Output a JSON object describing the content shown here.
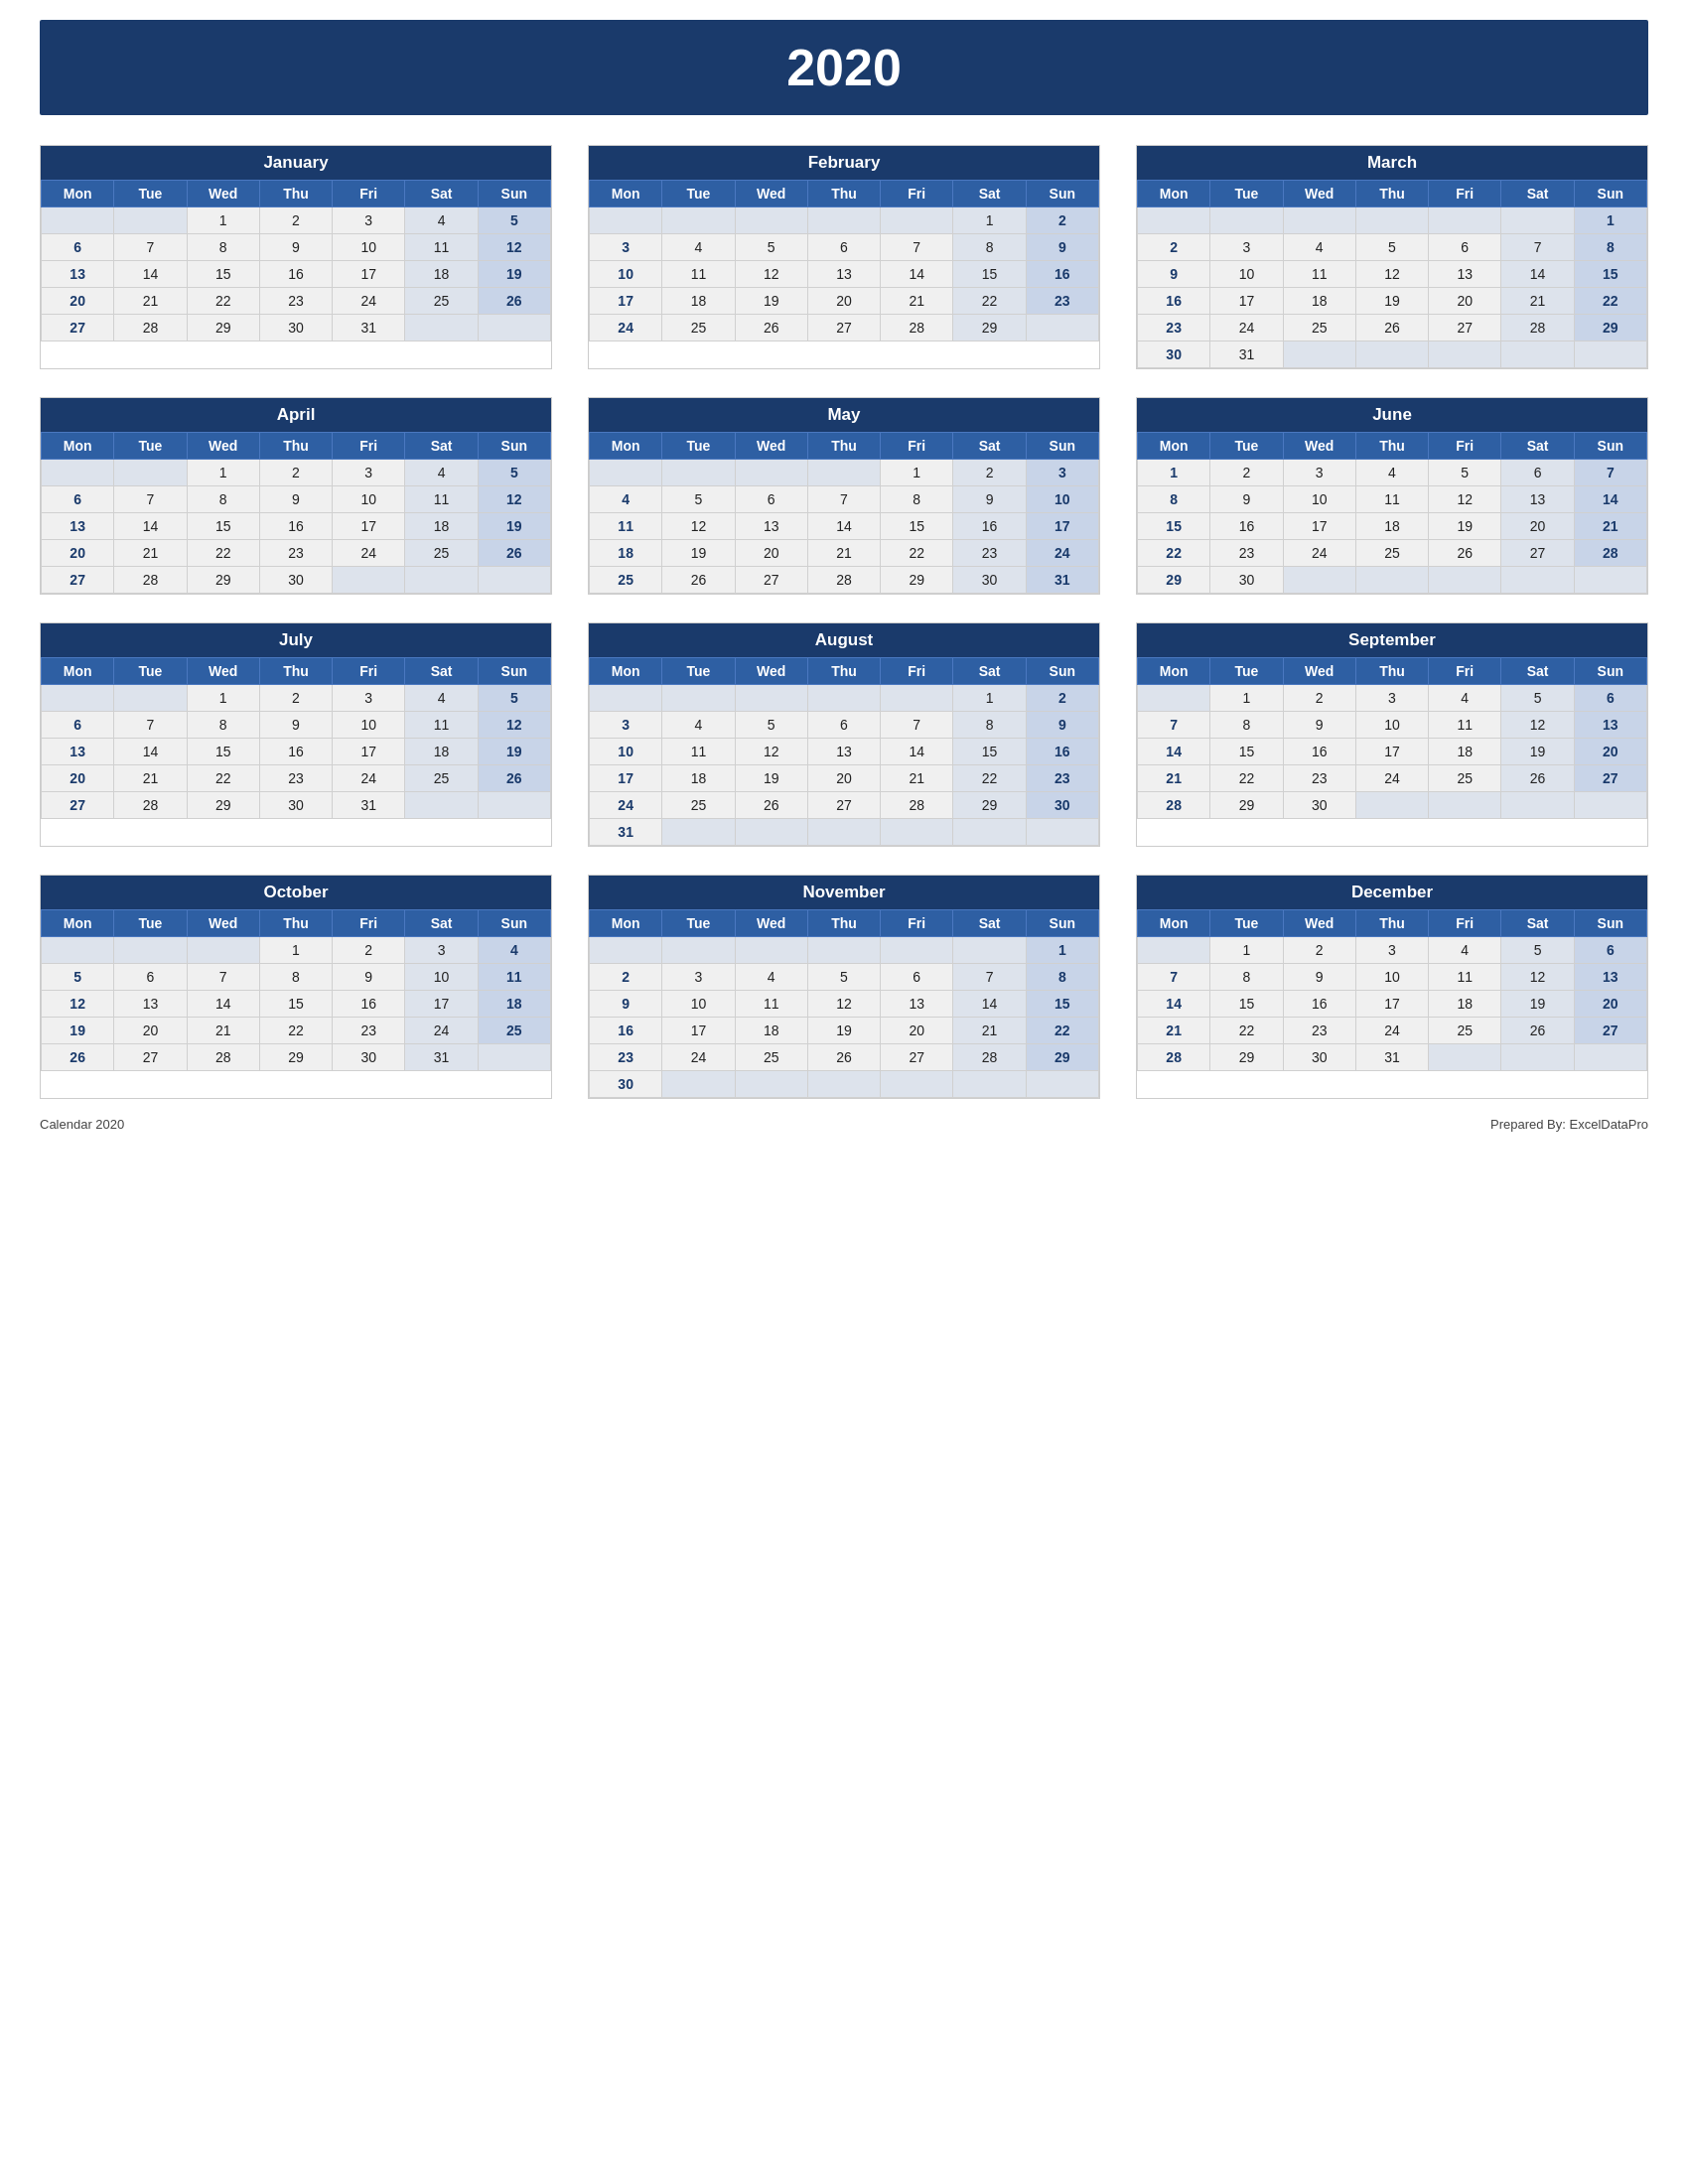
{
  "header": {
    "year": "2020"
  },
  "footer": {
    "left": "Calendar 2020",
    "right": "Prepared By: ExcelDataPro"
  },
  "weekdays": [
    "Mon",
    "Tue",
    "Wed",
    "Thu",
    "Fri",
    "Sat",
    "Sun"
  ],
  "months": [
    {
      "name": "January",
      "weeks": [
        [
          "",
          "",
          "1",
          "2",
          "3",
          "4",
          "5"
        ],
        [
          "6",
          "7",
          "8",
          "9",
          "10",
          "11",
          "12"
        ],
        [
          "13",
          "14",
          "15",
          "16",
          "17",
          "18",
          "19"
        ],
        [
          "20",
          "21",
          "22",
          "23",
          "24",
          "25",
          "26"
        ],
        [
          "27",
          "28",
          "29",
          "30",
          "31",
          "",
          ""
        ]
      ]
    },
    {
      "name": "February",
      "weeks": [
        [
          "",
          "",
          "",
          "",
          "",
          "1",
          "2"
        ],
        [
          "3",
          "4",
          "5",
          "6",
          "7",
          "8",
          "9"
        ],
        [
          "10",
          "11",
          "12",
          "13",
          "14",
          "15",
          "16"
        ],
        [
          "17",
          "18",
          "19",
          "20",
          "21",
          "22",
          "23"
        ],
        [
          "24",
          "25",
          "26",
          "27",
          "28",
          "29",
          ""
        ]
      ]
    },
    {
      "name": "March",
      "weeks": [
        [
          "",
          "",
          "",
          "",
          "",
          "",
          "1"
        ],
        [
          "2",
          "3",
          "4",
          "5",
          "6",
          "7",
          "8"
        ],
        [
          "9",
          "10",
          "11",
          "12",
          "13",
          "14",
          "15"
        ],
        [
          "16",
          "17",
          "18",
          "19",
          "20",
          "21",
          "22"
        ],
        [
          "23",
          "24",
          "25",
          "26",
          "27",
          "28",
          "29"
        ],
        [
          "30",
          "31",
          "",
          "",
          "",
          "",
          ""
        ]
      ]
    },
    {
      "name": "April",
      "weeks": [
        [
          "",
          "",
          "1",
          "2",
          "3",
          "4",
          "5"
        ],
        [
          "6",
          "7",
          "8",
          "9",
          "10",
          "11",
          "12"
        ],
        [
          "13",
          "14",
          "15",
          "16",
          "17",
          "18",
          "19"
        ],
        [
          "20",
          "21",
          "22",
          "23",
          "24",
          "25",
          "26"
        ],
        [
          "27",
          "28",
          "29",
          "30",
          "",
          "",
          ""
        ]
      ]
    },
    {
      "name": "May",
      "weeks": [
        [
          "",
          "",
          "",
          "",
          "1",
          "2",
          "3"
        ],
        [
          "4",
          "5",
          "6",
          "7",
          "8",
          "9",
          "10"
        ],
        [
          "11",
          "12",
          "13",
          "14",
          "15",
          "16",
          "17"
        ],
        [
          "18",
          "19",
          "20",
          "21",
          "22",
          "23",
          "24"
        ],
        [
          "25",
          "26",
          "27",
          "28",
          "29",
          "30",
          "31"
        ]
      ]
    },
    {
      "name": "June",
      "weeks": [
        [
          "1",
          "2",
          "3",
          "4",
          "5",
          "6",
          "7"
        ],
        [
          "8",
          "9",
          "10",
          "11",
          "12",
          "13",
          "14"
        ],
        [
          "15",
          "16",
          "17",
          "18",
          "19",
          "20",
          "21"
        ],
        [
          "22",
          "23",
          "24",
          "25",
          "26",
          "27",
          "28"
        ],
        [
          "29",
          "30",
          "",
          "",
          "",
          "",
          ""
        ]
      ]
    },
    {
      "name": "July",
      "weeks": [
        [
          "",
          "",
          "1",
          "2",
          "3",
          "4",
          "5"
        ],
        [
          "6",
          "7",
          "8",
          "9",
          "10",
          "11",
          "12"
        ],
        [
          "13",
          "14",
          "15",
          "16",
          "17",
          "18",
          "19"
        ],
        [
          "20",
          "21",
          "22",
          "23",
          "24",
          "25",
          "26"
        ],
        [
          "27",
          "28",
          "29",
          "30",
          "31",
          "",
          ""
        ]
      ]
    },
    {
      "name": "August",
      "weeks": [
        [
          "",
          "",
          "",
          "",
          "",
          "1",
          "2"
        ],
        [
          "3",
          "4",
          "5",
          "6",
          "7",
          "8",
          "9"
        ],
        [
          "10",
          "11",
          "12",
          "13",
          "14",
          "15",
          "16"
        ],
        [
          "17",
          "18",
          "19",
          "20",
          "21",
          "22",
          "23"
        ],
        [
          "24",
          "25",
          "26",
          "27",
          "28",
          "29",
          "30"
        ],
        [
          "31",
          "",
          "",
          "",
          "",
          "",
          ""
        ]
      ]
    },
    {
      "name": "September",
      "weeks": [
        [
          "",
          "1",
          "2",
          "3",
          "4",
          "5",
          "6"
        ],
        [
          "7",
          "8",
          "9",
          "10",
          "11",
          "12",
          "13"
        ],
        [
          "14",
          "15",
          "16",
          "17",
          "18",
          "19",
          "20"
        ],
        [
          "21",
          "22",
          "23",
          "24",
          "25",
          "26",
          "27"
        ],
        [
          "28",
          "29",
          "30",
          "",
          "",
          "",
          ""
        ]
      ]
    },
    {
      "name": "October",
      "weeks": [
        [
          "",
          "",
          "",
          "1",
          "2",
          "3",
          "4"
        ],
        [
          "5",
          "6",
          "7",
          "8",
          "9",
          "10",
          "11"
        ],
        [
          "12",
          "13",
          "14",
          "15",
          "16",
          "17",
          "18"
        ],
        [
          "19",
          "20",
          "21",
          "22",
          "23",
          "24",
          "25"
        ],
        [
          "26",
          "27",
          "28",
          "29",
          "30",
          "31",
          ""
        ]
      ]
    },
    {
      "name": "November",
      "weeks": [
        [
          "",
          "",
          "",
          "",
          "",
          "",
          "1"
        ],
        [
          "2",
          "3",
          "4",
          "5",
          "6",
          "7",
          "8"
        ],
        [
          "9",
          "10",
          "11",
          "12",
          "13",
          "14",
          "15"
        ],
        [
          "16",
          "17",
          "18",
          "19",
          "20",
          "21",
          "22"
        ],
        [
          "23",
          "24",
          "25",
          "26",
          "27",
          "28",
          "29"
        ],
        [
          "30",
          "",
          "",
          "",
          "",
          "",
          ""
        ]
      ]
    },
    {
      "name": "December",
      "weeks": [
        [
          "",
          "1",
          "2",
          "3",
          "4",
          "5",
          "6"
        ],
        [
          "7",
          "8",
          "9",
          "10",
          "11",
          "12",
          "13"
        ],
        [
          "14",
          "15",
          "16",
          "17",
          "18",
          "19",
          "20"
        ],
        [
          "21",
          "22",
          "23",
          "24",
          "25",
          "26",
          "27"
        ],
        [
          "28",
          "29",
          "30",
          "31",
          "",
          "",
          ""
        ]
      ]
    }
  ]
}
